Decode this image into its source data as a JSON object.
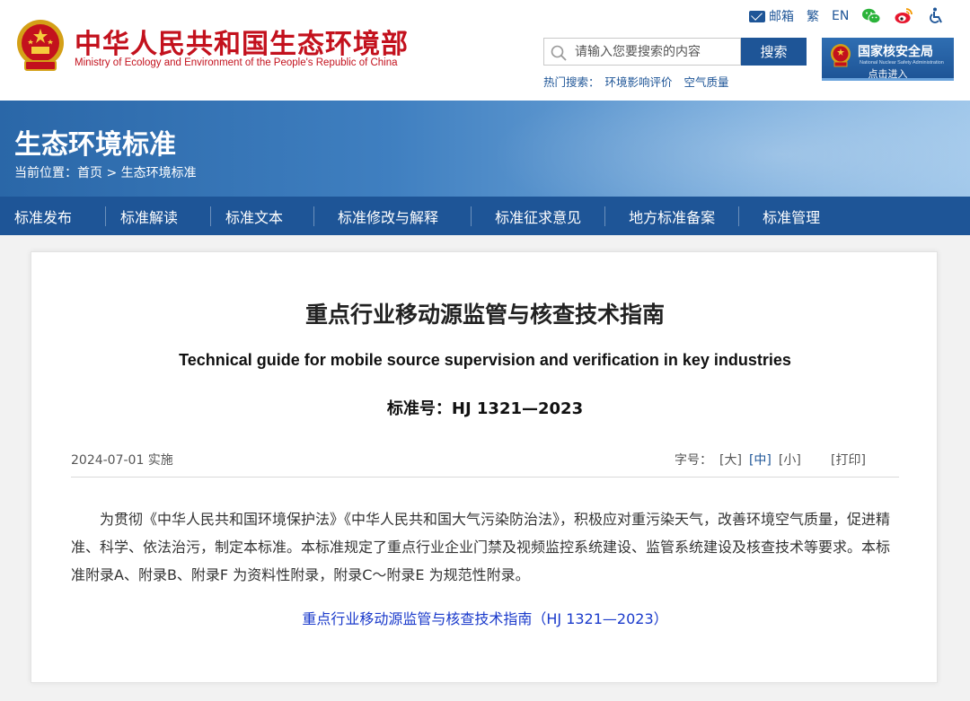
{
  "header": {
    "title_cn": "中华人民共和国生态环境部",
    "title_en": "Ministry of Ecology and Environment of the People's Republic of China",
    "toplinks": {
      "mail": "邮箱",
      "traditional": "繁",
      "english": "EN"
    },
    "search": {
      "placeholder": "请输入您要搜索的内容",
      "button": "搜索"
    },
    "hot_search": {
      "label": "热门搜索：",
      "items": [
        "环境影响评价",
        "空气质量"
      ]
    },
    "nnsa": {
      "title": "国家核安全局",
      "en": "National Nuclear Safety Administration",
      "enter": "点击进入"
    }
  },
  "banner": {
    "title": "生态环境标准",
    "breadcrumb": {
      "label": "当前位置：",
      "home": "首页",
      "sep": ">",
      "current": "生态环境标准"
    }
  },
  "nav": {
    "items": [
      "标准发布",
      "标准解读",
      "标准文本",
      "标准修改与解释",
      "标准征求意见",
      "地方标准备案",
      "标准管理"
    ]
  },
  "article": {
    "title": "重点行业移动源监管与核查技术指南",
    "title_en": "Technical guide for mobile source supervision and verification in key industries",
    "standard_no": "标准号：HJ 1321—2023",
    "date": "2024-07-01 实施",
    "font_size": {
      "label": "字号：",
      "large": "[大]",
      "medium": "[中]",
      "small": "[小]",
      "selected": "中"
    },
    "print": "[打印]",
    "body": "为贯彻《中华人民共和国环境保护法》《中华人民共和国大气污染防治法》，积极应对重污染天气，改善环境空气质量，促进精准、科学、依法治污，制定本标准。本标准规定了重点行业企业门禁及视频监控系统建设、监管系统建设及核查技术等要求。本标准附录A、附录B、附录F 为资料性附录，附录C～附录E 为规范性附录。",
    "attachment": "重点行业移动源监管与核查技术指南（HJ 1321—2023）"
  },
  "colors": {
    "brand_red": "#c3111d",
    "brand_blue": "#1e5597",
    "link_blue": "#1a3acb"
  },
  "icons": [
    "emblem-icon",
    "mail-icon",
    "wechat-icon",
    "weibo-icon",
    "accessibility-icon",
    "search-icon",
    "nnsa-emblem-icon"
  ]
}
